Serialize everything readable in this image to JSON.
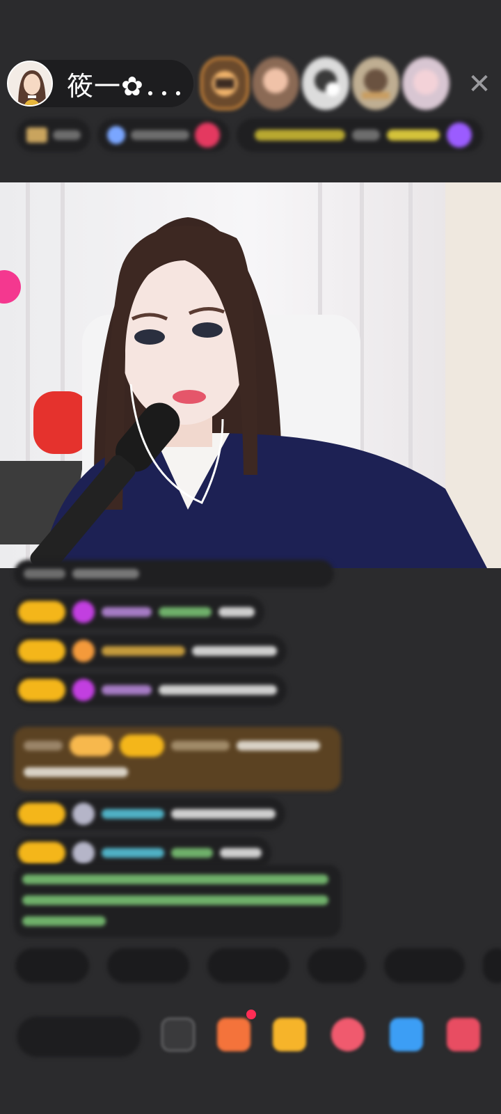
{
  "header": {
    "host_name": "筱一✿．．．",
    "close_glyph": "✕",
    "badges": {
      "hot_text": "",
      "extra": ""
    }
  },
  "colors": {
    "background": "#2b2b2d",
    "pill": "#1f1f21",
    "level_badge": "#f4b61a",
    "viewer_border": "#f19a3c"
  },
  "chat": {
    "messages": [
      {
        "kind": "partial-top"
      },
      {
        "kind": "level-badge",
        "icon": "purple-gem-icon"
      },
      {
        "kind": "level-badge",
        "icon": "orange-icon"
      },
      {
        "kind": "level-badge",
        "icon": "purple-gem-icon"
      },
      {
        "kind": "highlight-brown"
      },
      {
        "kind": "level-badge",
        "icon": "gray-icon"
      },
      {
        "kind": "level-badge",
        "icon": "gray-icon"
      },
      {
        "kind": "system-green"
      }
    ]
  },
  "quick_chips": [
    {
      "label": ""
    },
    {
      "label": ""
    },
    {
      "label": ""
    },
    {
      "label": ""
    },
    {
      "label": ""
    },
    {
      "label": ""
    }
  ],
  "bottom_bar": {
    "input_placeholder": "",
    "icons": [
      "emoji-icon",
      "gift-box-icon",
      "gift-bag-icon",
      "heart-gift-icon",
      "game-icon",
      "more-grid-icon"
    ]
  }
}
